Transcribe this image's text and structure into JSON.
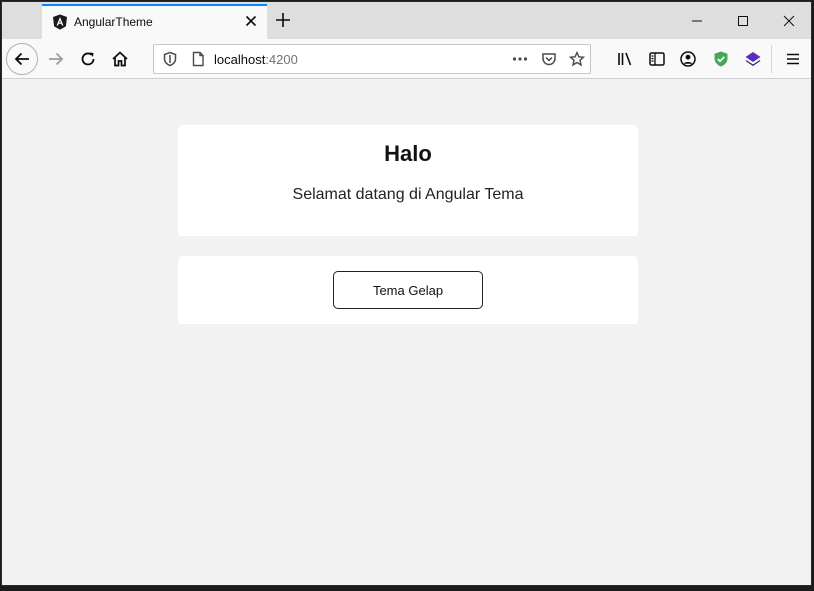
{
  "browser": {
    "tab": {
      "title": "AngularTheme",
      "favicon": "angular-icon"
    },
    "url": {
      "host": "localhost",
      "port": ":4200"
    },
    "icons": {
      "back": "arrow-left-icon",
      "forward": "arrow-right-icon",
      "reload": "reload-icon",
      "home": "home-icon",
      "page_actions": "ellipsis-icon",
      "pocket": "pocket-icon",
      "bookmark": "star-icon",
      "library": "library-icon",
      "sidebar": "sidebar-icon",
      "account": "account-icon",
      "extension_shield": "shield-icon",
      "extension_layers": "layers-icon",
      "menu": "hamburger-icon"
    },
    "colors": {
      "tab_accent": "#0a84ff",
      "shield": "#45a858",
      "layers": "#5a2bbf"
    }
  },
  "page": {
    "greeting": {
      "title": "Halo",
      "subtitle": "Selamat datang di Angular Tema"
    },
    "theme_button": {
      "label": "Tema Gelap"
    }
  }
}
